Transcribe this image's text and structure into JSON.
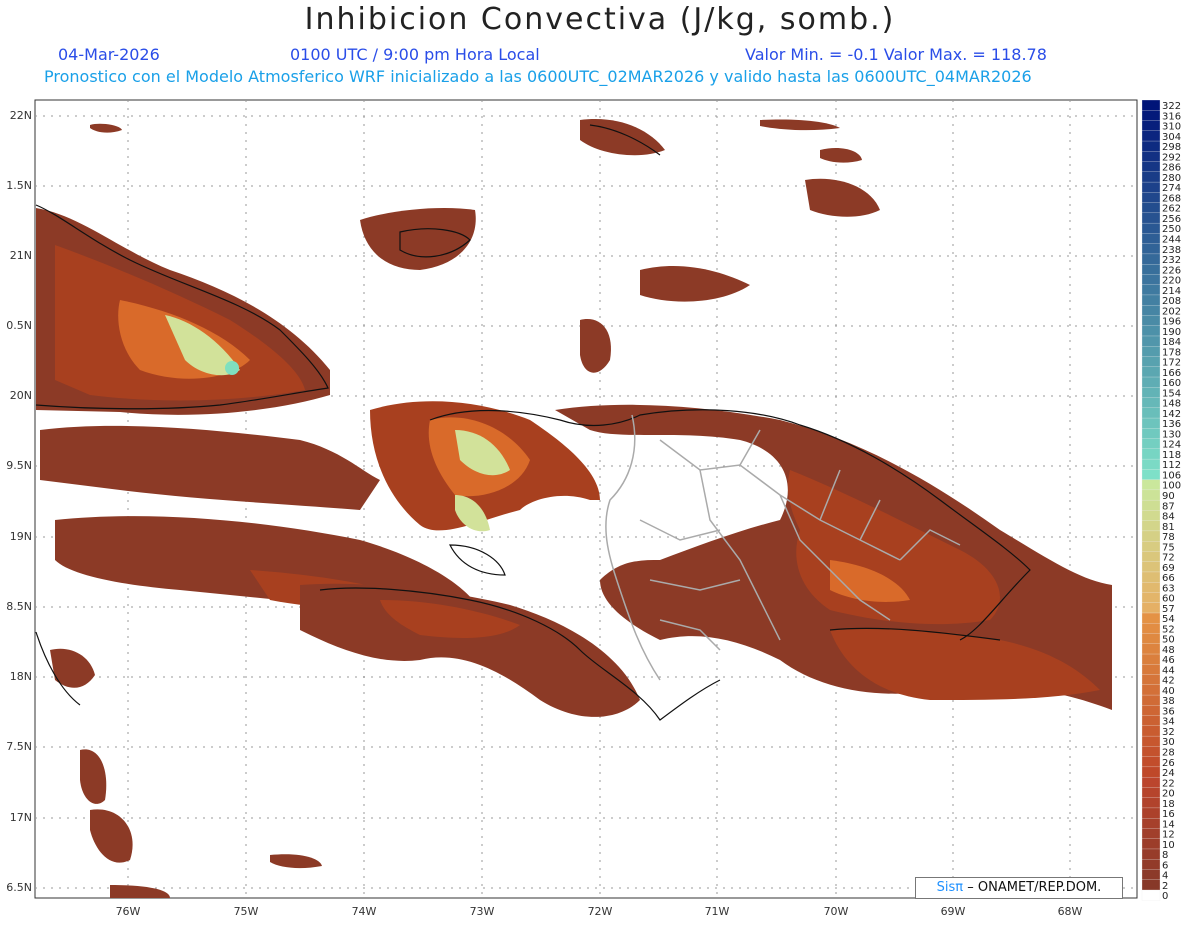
{
  "header": {
    "title": "Inhibicion Convectiva (J/kg, somb.)",
    "date": "04-Mar-2026",
    "time": "0100 UTC / 9:00 pm Hora Local",
    "minmax": "Valor Min. = -0.1  Valor Max. = 118.78",
    "subtitle": "Pronostico con el Modelo Atmosferico WRF inicializado a las 0600UTC_02MAR2026 y valido hasta las  0600UTC_04MAR2026"
  },
  "axes": {
    "lat_labels": [
      "22N",
      "1.5N",
      "21N",
      "0.5N",
      "20N",
      "9.5N",
      "19N",
      "8.5N",
      "18N",
      "7.5N",
      "17N",
      "6.5N"
    ],
    "lon_labels": [
      "76W",
      "75W",
      "74W",
      "73W",
      "72W",
      "71W",
      "70W",
      "69W",
      "68W"
    ]
  },
  "colorbar": {
    "labels": [
      "322",
      "316",
      "310",
      "304",
      "298",
      "292",
      "286",
      "280",
      "274",
      "268",
      "262",
      "256",
      "250",
      "244",
      "238",
      "232",
      "226",
      "220",
      "214",
      "208",
      "202",
      "196",
      "190",
      "184",
      "178",
      "172",
      "166",
      "160",
      "154",
      "148",
      "142",
      "136",
      "130",
      "124",
      "118",
      "112",
      "106",
      "100",
      "90",
      "87",
      "84",
      "81",
      "78",
      "75",
      "72",
      "69",
      "66",
      "63",
      "60",
      "57",
      "54",
      "52",
      "50",
      "48",
      "46",
      "44",
      "42",
      "40",
      "38",
      "36",
      "34",
      "32",
      "30",
      "28",
      "26",
      "24",
      "22",
      "20",
      "18",
      "16",
      "14",
      "12",
      "10",
      "8",
      "6",
      "4",
      "2",
      "0"
    ]
  },
  "credit": {
    "brand": "Sisπ",
    "text": "– ONAMET/REP.DOM."
  },
  "colors": {
    "dark_red": "#8c3a26",
    "red": "#a8401f",
    "orange": "#d96a2a",
    "light_orange": "#e8903f",
    "yellow_green": "#d2e29a",
    "aqua": "#7fe0bf",
    "coast": "#111111",
    "border": "#aaaaaa",
    "header_blue": "#2a4de8",
    "header_cyan": "#1aa0e8"
  }
}
